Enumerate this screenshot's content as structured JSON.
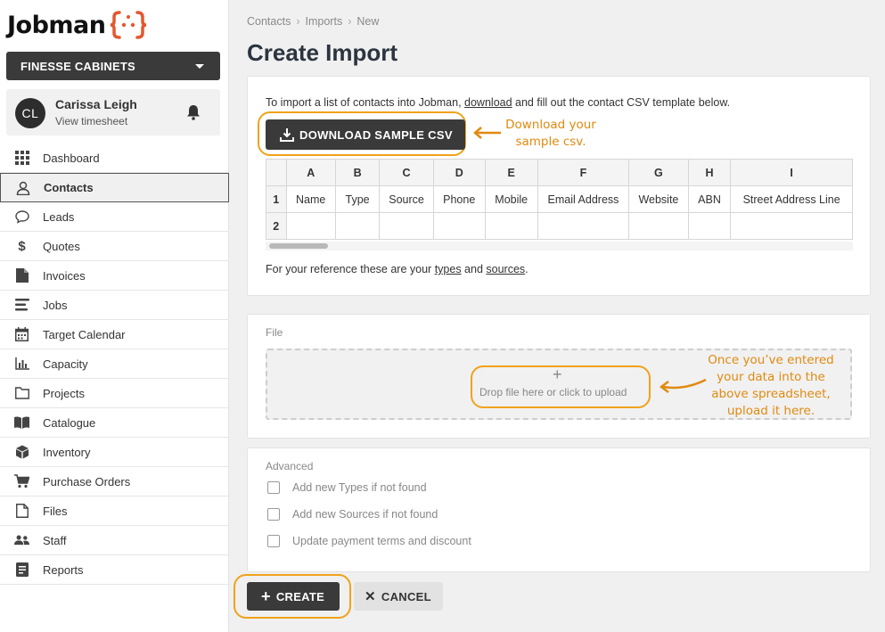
{
  "brand": {
    "name": "Jobman",
    "accent": "#e4572e"
  },
  "sidebar": {
    "company": "FINESSE CABINETS",
    "user": {
      "initials": "CL",
      "name": "Carissa Leigh",
      "sub": "View timesheet"
    },
    "items": [
      {
        "label": "Dashboard",
        "icon": "grid-icon"
      },
      {
        "label": "Contacts",
        "icon": "person-icon",
        "active": true
      },
      {
        "label": "Leads",
        "icon": "chat-icon"
      },
      {
        "label": "Quotes",
        "icon": "dollar-icon"
      },
      {
        "label": "Invoices",
        "icon": "document-icon"
      },
      {
        "label": "Jobs",
        "icon": "list-icon"
      },
      {
        "label": "Target Calendar",
        "icon": "calendar-icon"
      },
      {
        "label": "Capacity",
        "icon": "bar-chart-icon"
      },
      {
        "label": "Projects",
        "icon": "folder-icon"
      },
      {
        "label": "Catalogue",
        "icon": "book-icon"
      },
      {
        "label": "Inventory",
        "icon": "box-icon"
      },
      {
        "label": "Purchase Orders",
        "icon": "cart-icon"
      },
      {
        "label": "Files",
        "icon": "file-icon"
      },
      {
        "label": "Staff",
        "icon": "users-icon"
      },
      {
        "label": "Reports",
        "icon": "report-icon"
      }
    ]
  },
  "breadcrumb": [
    "Contacts",
    "Imports",
    "New"
  ],
  "page_title": "Create Import",
  "template_card": {
    "intro_pre": "To import a list of contacts into Jobman, ",
    "intro_link": "download",
    "intro_post": " and fill out the contact CSV template below.",
    "download_label": "DOWNLOAD SAMPLE CSV",
    "columns": [
      "A",
      "B",
      "C",
      "D",
      "E",
      "F",
      "G",
      "H",
      "I"
    ],
    "row_numbers": [
      "1",
      "2"
    ],
    "headers": [
      "Name",
      "Type",
      "Source",
      "Phone",
      "Mobile",
      "Email Address",
      "Website",
      "ABN",
      "Street Address Line"
    ],
    "ref_pre": "For your reference these are your ",
    "ref_link1": "types",
    "ref_mid": " and ",
    "ref_link2": "sources",
    "ref_post": "."
  },
  "annotations": {
    "download_1": "Download your",
    "download_2": "sample csv.",
    "upload_1": "Once you’ve entered",
    "upload_2": "your data into the",
    "upload_3": "above spreadsheet,",
    "upload_4": "upload it here."
  },
  "file_card": {
    "label": "File",
    "drop_plus": "+",
    "drop_text": "Drop file here or click to upload"
  },
  "advanced_card": {
    "label": "Advanced",
    "options": [
      "Add new Types if not found",
      "Add new Sources if not found",
      "Update payment terms and discount"
    ]
  },
  "actions": {
    "create": "CREATE",
    "cancel": "CANCEL"
  }
}
